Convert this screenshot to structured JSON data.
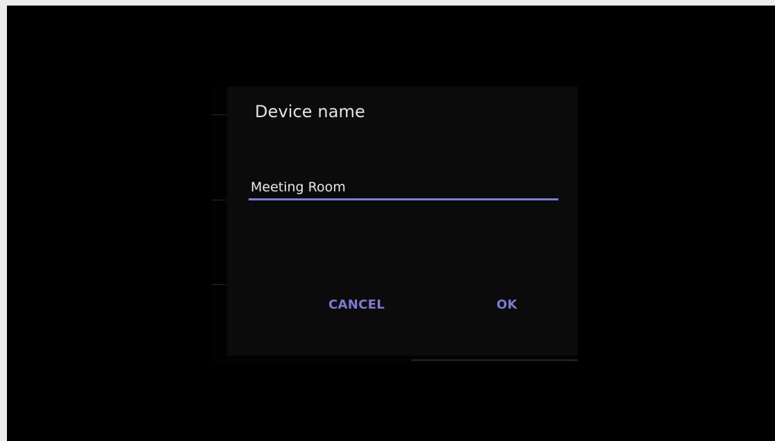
{
  "dialog": {
    "title": "Device name",
    "field": {
      "value": "Meeting Room",
      "placeholder": ""
    },
    "buttons": {
      "cancel_label": "CANCEL",
      "ok_label": "OK"
    }
  },
  "colors": {
    "accent": "#7b7bd2",
    "dialog_background": "#0b0b0b",
    "screen_background": "#000000",
    "title_text": "#e3e3e3"
  }
}
